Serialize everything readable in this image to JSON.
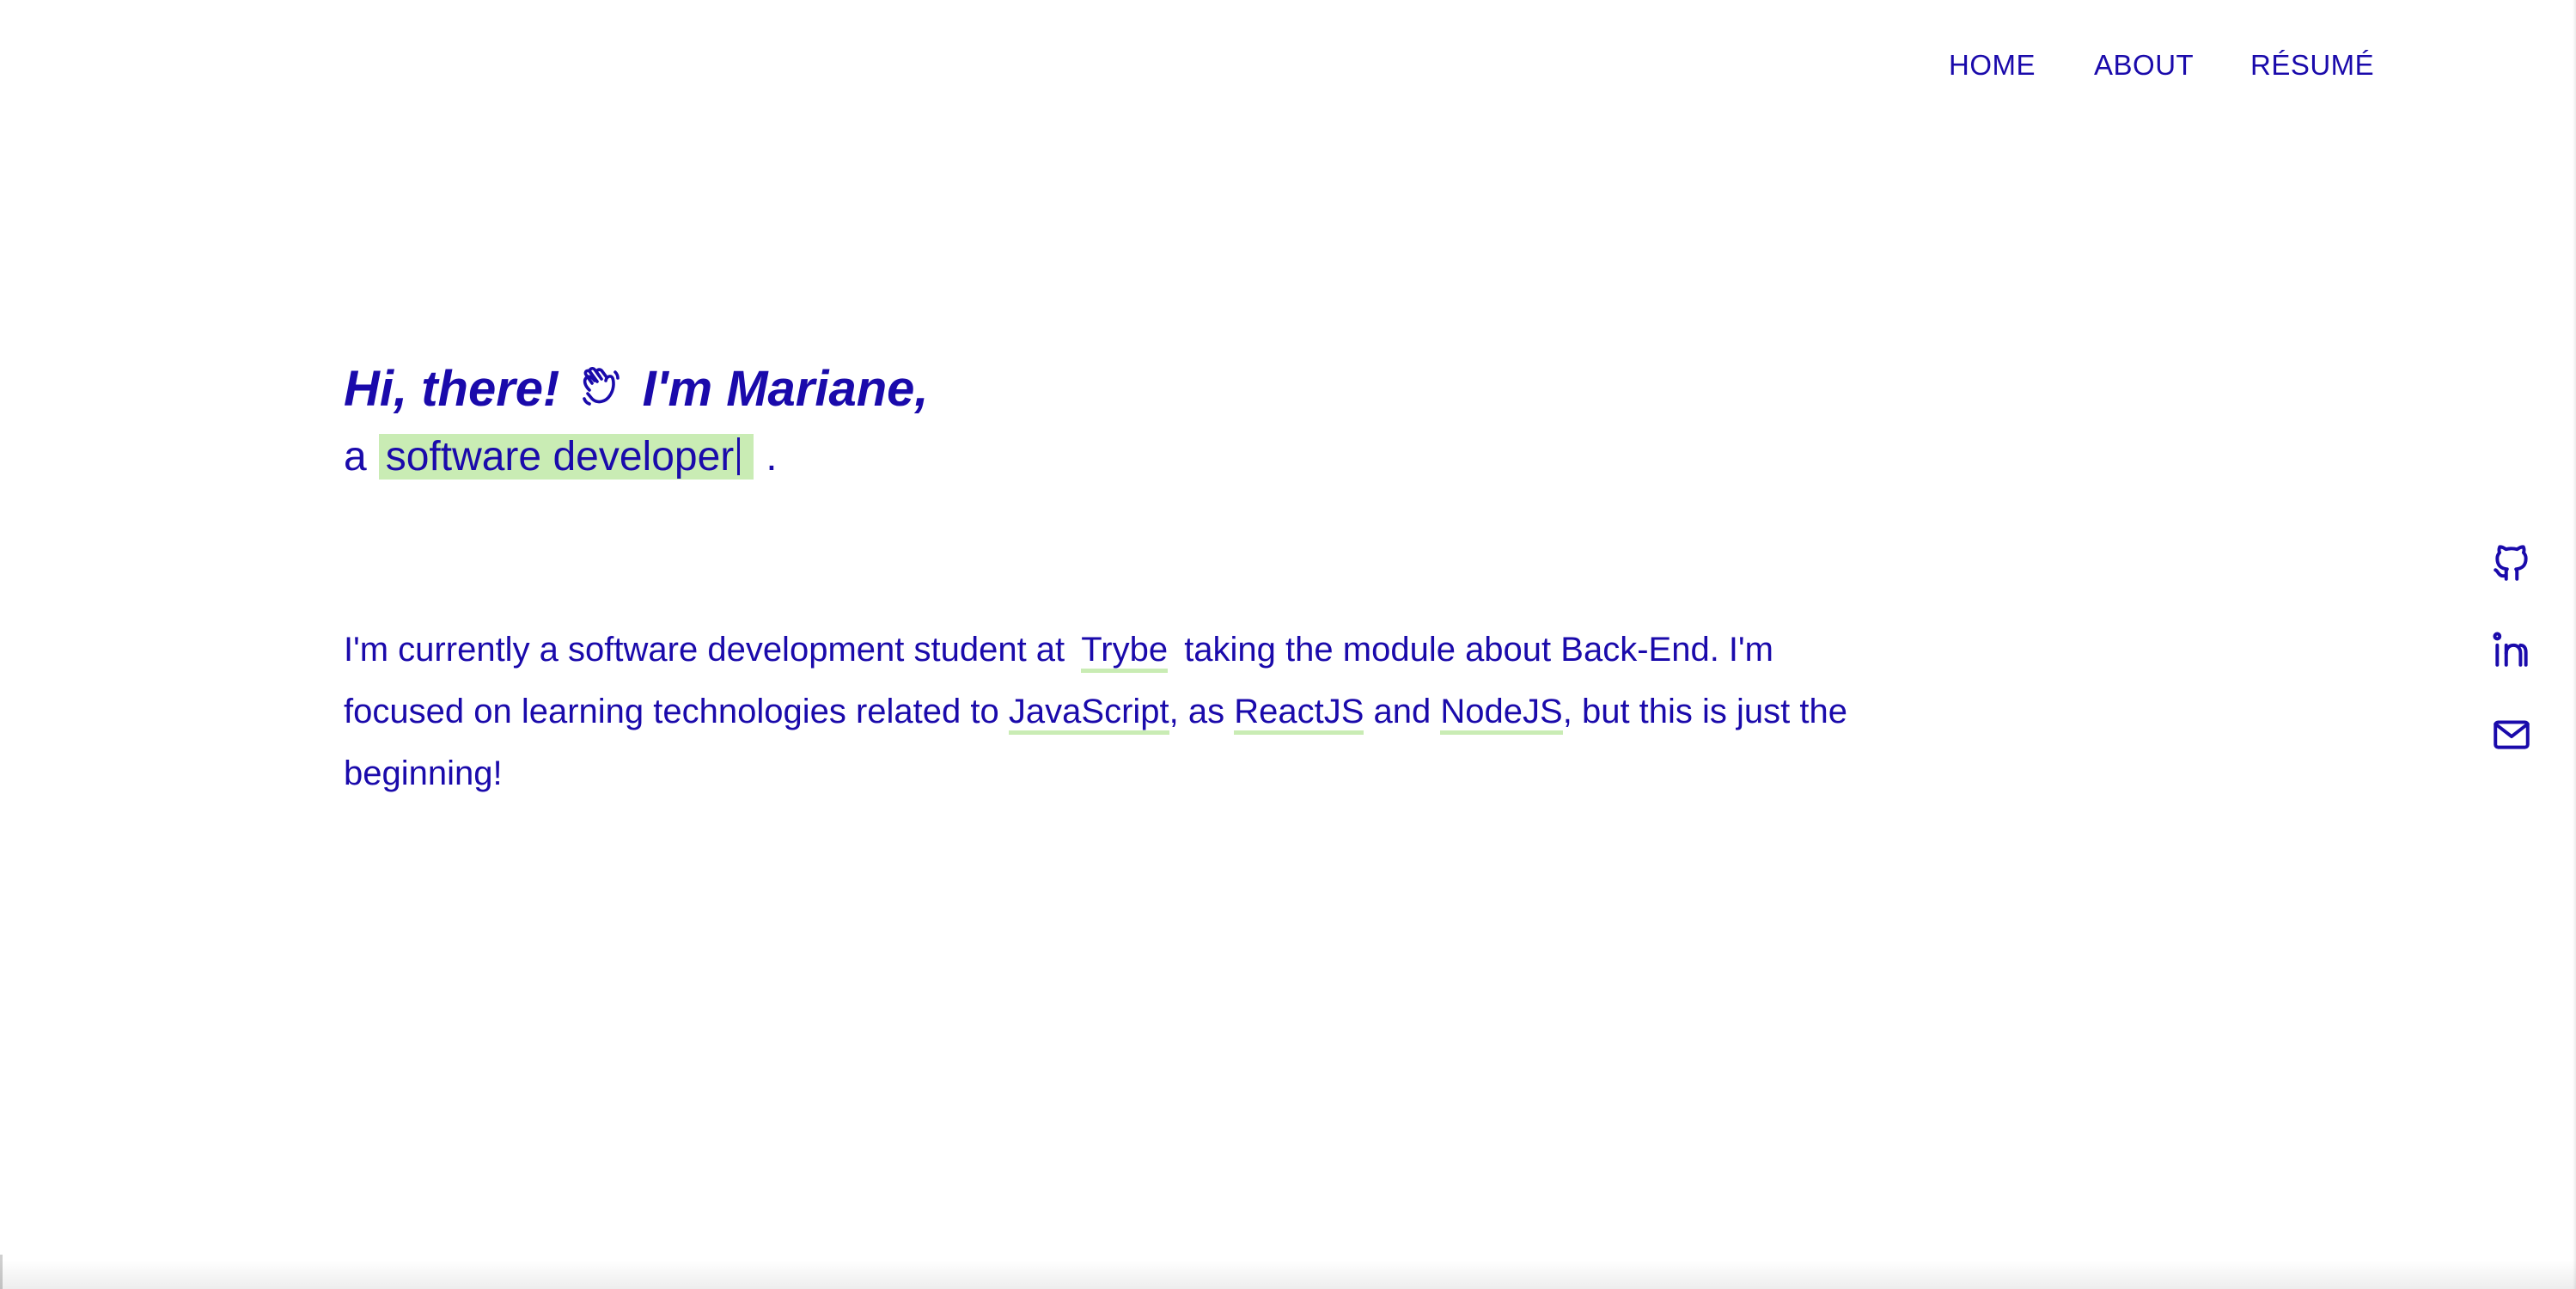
{
  "nav": {
    "home": "HOME",
    "about": "ABOUT",
    "resume": "RÉSUMÉ"
  },
  "hero": {
    "greeting_before": "Hi, there!",
    "greeting_after": "I'm Mariane,",
    "role_prefix": "a",
    "role_text": "software developer",
    "role_suffix": ".",
    "wave_icon": "waving-hand-icon"
  },
  "bio": {
    "part1": "I'm currently a software development student at",
    "trybe": "Trybe",
    "part2": "taking the module about Back-End. I'm focused on learning technologies related to",
    "javascript": "JavaScript",
    "part3": ", as",
    "reactjs": "ReactJS",
    "part4": "and",
    "nodejs": "NodeJS",
    "part5": ", but this is just the beginning!"
  },
  "social": {
    "icons": [
      "github-icon",
      "linkedin-icon",
      "mail-icon"
    ]
  },
  "colors": {
    "text": "#1a0aab",
    "highlight": "#c9ecb4",
    "background": "#ffffff"
  }
}
